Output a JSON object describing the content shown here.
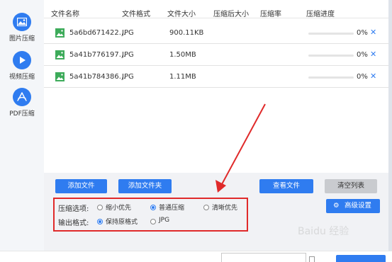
{
  "sidebar": {
    "items": [
      {
        "label": "图片压缩",
        "icon": "image-icon"
      },
      {
        "label": "视频压缩",
        "icon": "play-icon"
      },
      {
        "label": "PDF压缩",
        "icon": "pdf-icon"
      }
    ]
  },
  "table": {
    "headers": [
      "文件名称",
      "文件格式",
      "文件大小",
      "压缩后大小",
      "压缩率",
      "压缩进度"
    ],
    "rows": [
      {
        "name": "5a6bd671422...",
        "format": "JPG",
        "size": "900.11KB",
        "compressed_size": "",
        "ratio": "",
        "progress": 0,
        "progress_text": "0%"
      },
      {
        "name": "5a41b776197...",
        "format": "JPG",
        "size": "1.50MB",
        "compressed_size": "",
        "ratio": "",
        "progress": 0,
        "progress_text": "0%"
      },
      {
        "name": "5a41b784386...",
        "format": "JPG",
        "size": "1.11MB",
        "compressed_size": "",
        "ratio": "",
        "progress": 0,
        "progress_text": "0%"
      }
    ],
    "remove_glyph": "✕"
  },
  "buttons": {
    "add_file": "添加文件",
    "add_folder": "添加文件夹",
    "view_file": "查看文件",
    "clear_list": "清空列表",
    "advanced": "高级设置"
  },
  "options": {
    "compress_label": "压缩选项:",
    "compress_choices": [
      "缩小优先",
      "普通压缩",
      "清晰优先"
    ],
    "compress_selected": "普通压缩",
    "format_label": "输出格式:",
    "format_choices": [
      "保持原格式",
      "JPG"
    ],
    "format_selected": "保持原格式"
  },
  "watermark": "Baidu 经验",
  "colors": {
    "accent": "#2f7cf0",
    "highlight_box": "#e02a2a",
    "file_icon": "#3dab5a"
  }
}
